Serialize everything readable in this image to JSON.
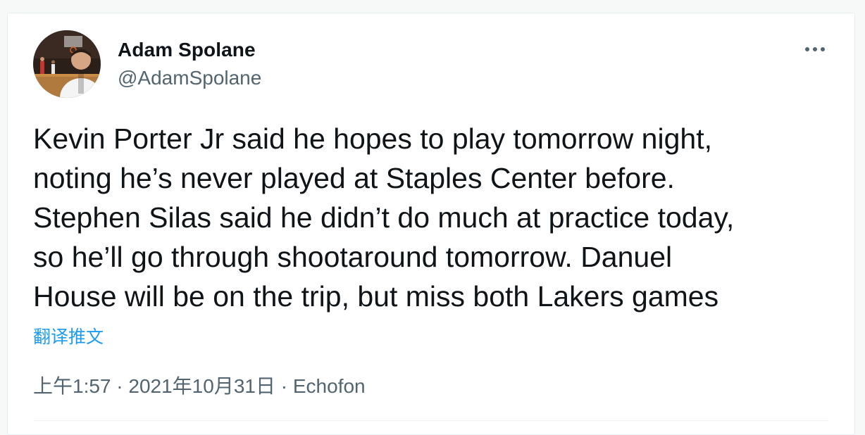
{
  "tweet": {
    "author_name": "Adam Spolane",
    "author_handle": "@AdamSpolane",
    "text": "Kevin Porter Jr said he hopes to play tomorrow night,\nnoting he’s never played at Staples Center before.\nStephen Silas said he didn’t do much at practice today,\nso he’ll go through shootaround tomorrow. Danuel\nHouse will be on the trip, but miss both Lakers games",
    "translate_label": "翻译推文",
    "time": "上午1:57",
    "date": "2021年10月31日",
    "source": "Echofon",
    "separator": "·"
  },
  "icons": {
    "more": "more-horizontal-icon",
    "avatar": "avatar"
  },
  "colors": {
    "link": "#1d9bf0",
    "secondary_text": "#536471",
    "primary_text": "#0f1419"
  }
}
